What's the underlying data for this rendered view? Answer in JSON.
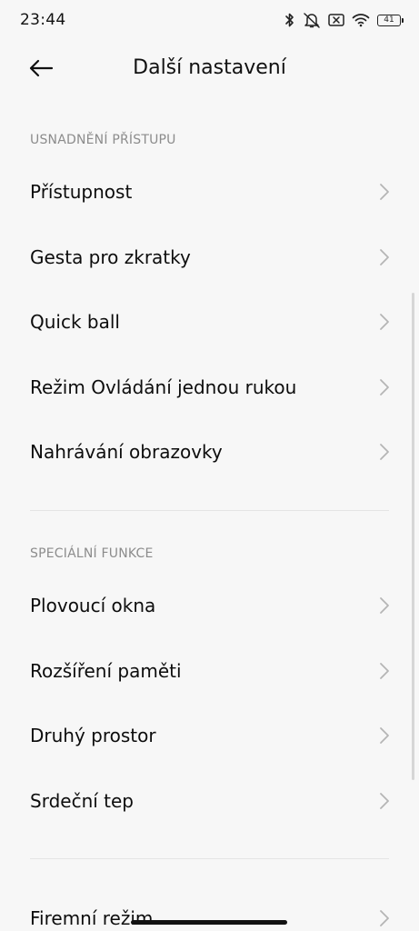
{
  "status_bar": {
    "time": "23:44",
    "battery_level": "41",
    "icons": [
      "bluetooth-icon",
      "vibrate-off-icon",
      "no-sim-icon",
      "wifi-icon",
      "battery-icon"
    ]
  },
  "header": {
    "title": "Další nastavení",
    "back_icon": "arrow-left-icon"
  },
  "sections": [
    {
      "title": "USNADNĚNÍ PŘÍSTUPU",
      "items": [
        {
          "label": "Přístupnost"
        },
        {
          "label": "Gesta pro zkratky"
        },
        {
          "label": "Quick ball"
        },
        {
          "label": "Režim Ovládání jednou rukou"
        },
        {
          "label": "Nahrávání obrazovky"
        }
      ]
    },
    {
      "title": "SPECIÁLNÍ FUNKCE",
      "items": [
        {
          "label": "Plovoucí okna"
        },
        {
          "label": "Rozšíření paměti"
        },
        {
          "label": "Druhý prostor"
        },
        {
          "label": "Srdeční tep"
        }
      ]
    },
    {
      "title": "",
      "items": [
        {
          "label": "Firemní režim"
        }
      ]
    }
  ],
  "colors": {
    "background": "#f7f7f7",
    "text": "#0d0d0d",
    "section_header": "#8c8c8c",
    "chevron": "#b5b5b5",
    "divider": "#e4e4e4"
  }
}
